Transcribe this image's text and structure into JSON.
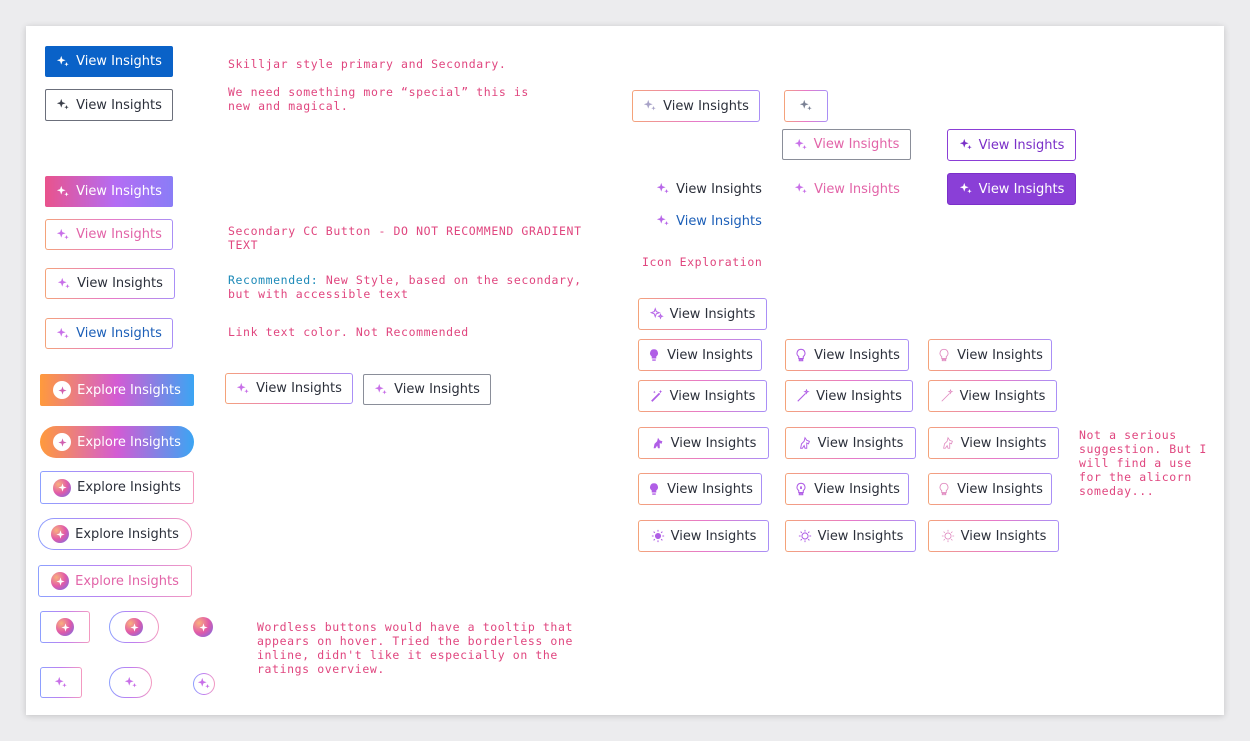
{
  "labels": {
    "view": "View Insights",
    "explore": "Explore Insights"
  },
  "notes": {
    "skilljar": "Skilljar style primary and Secondary.",
    "special": "We need something more “special” this is\nnew and magical.",
    "secondary_cc": "Secondary CC Button - DO NOT RECOMMEND GRADIENT\nTEXT",
    "recommended_label": "Recommended:",
    "recommended_text": " New Style, based on the secondary,\nbut with accessible text",
    "link_color": "Link text color. Not Recommended",
    "icon_exploration": "Icon Exploration",
    "alicorn": "Not a serious\nsuggestion. But I\nwill find a use\nfor the alicorn\nsomeday...",
    "wordless": "Wordless buttons would have a tooltip that\nappears on hover. Tried the borderless one\ninline, didn't like it especially on the\nratings overview."
  },
  "icons": {
    "sparkle": "sparkle-icon",
    "lightbulb": "lightbulb-icon",
    "magic_wand": "magic-wand-icon",
    "alicorn": "alicorn-icon",
    "orb": "sparkle-orb-icon"
  },
  "colors": {
    "primary_blue": "#0a62c8",
    "note_pink": "#e0467f",
    "recommended_blue": "#1d8ab8",
    "purple": "#8a3fd7",
    "link_blue": "#1c5fb8",
    "gradient_pink": "#e264a8"
  }
}
